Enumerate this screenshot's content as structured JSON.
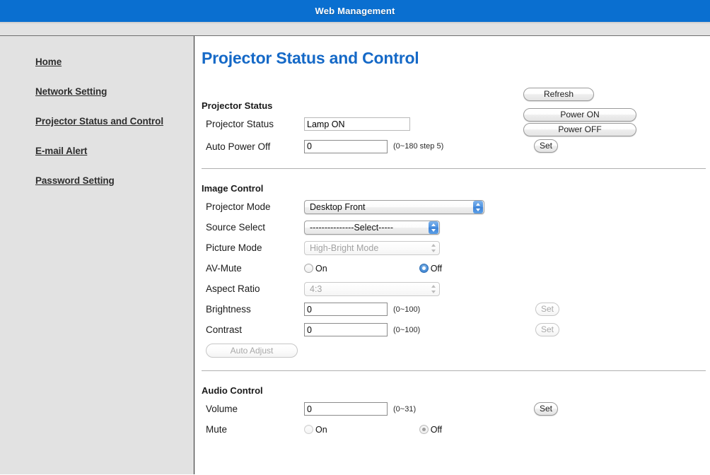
{
  "header": {
    "title": "Web Management"
  },
  "sidebar": {
    "items": [
      {
        "label": "Home",
        "name": "sidebar-item-home"
      },
      {
        "label": "Network Setting",
        "name": "sidebar-item-network-setting"
      },
      {
        "label": "Projector Status and Control",
        "name": "sidebar-item-projector-status-and-control"
      },
      {
        "label": "E-mail Alert",
        "name": "sidebar-item-email-alert"
      },
      {
        "label": "Password Setting",
        "name": "sidebar-item-password-setting"
      }
    ]
  },
  "page": {
    "title": "Projector Status and Control"
  },
  "projector_status": {
    "section_title": "Projector Status",
    "status_label": "Projector Status",
    "status_value": "Lamp ON",
    "auto_power_off_label": "Auto Power Off",
    "auto_power_off_value": "0",
    "auto_power_off_hint": "(0~180 step 5)",
    "refresh_label": "Refresh",
    "power_on_label": "Power ON",
    "power_off_label": "Power OFF",
    "set_label": "Set"
  },
  "image_control": {
    "section_title": "Image Control",
    "projector_mode_label": "Projector Mode",
    "projector_mode_value": "Desktop Front",
    "source_select_label": "Source Select",
    "source_select_value": "---------------Select-----",
    "picture_mode_label": "Picture Mode",
    "picture_mode_value": "High-Bright Mode",
    "av_mute_label": "AV-Mute",
    "av_mute_on_label": "On",
    "av_mute_off_label": "Off",
    "av_mute_selected": "Off",
    "aspect_ratio_label": "Aspect Ratio",
    "aspect_ratio_value": "4:3",
    "brightness_label": "Brightness",
    "brightness_value": "0",
    "brightness_hint": "(0~100)",
    "brightness_set_label": "Set",
    "contrast_label": "Contrast",
    "contrast_value": "0",
    "contrast_hint": "(0~100)",
    "contrast_set_label": "Set",
    "auto_adjust_label": "Auto Adjust"
  },
  "audio_control": {
    "section_title": "Audio Control",
    "volume_label": "Volume",
    "volume_value": "0",
    "volume_hint": "(0~31)",
    "volume_set_label": "Set",
    "mute_label": "Mute",
    "mute_on_label": "On",
    "mute_off_label": "Off",
    "mute_selected": "Off"
  },
  "colors": {
    "banner": "#0a6fd0",
    "title": "#1569c7",
    "sidebar_bg": "#e2e2e2",
    "accent_blue": "#4b8fd8"
  }
}
